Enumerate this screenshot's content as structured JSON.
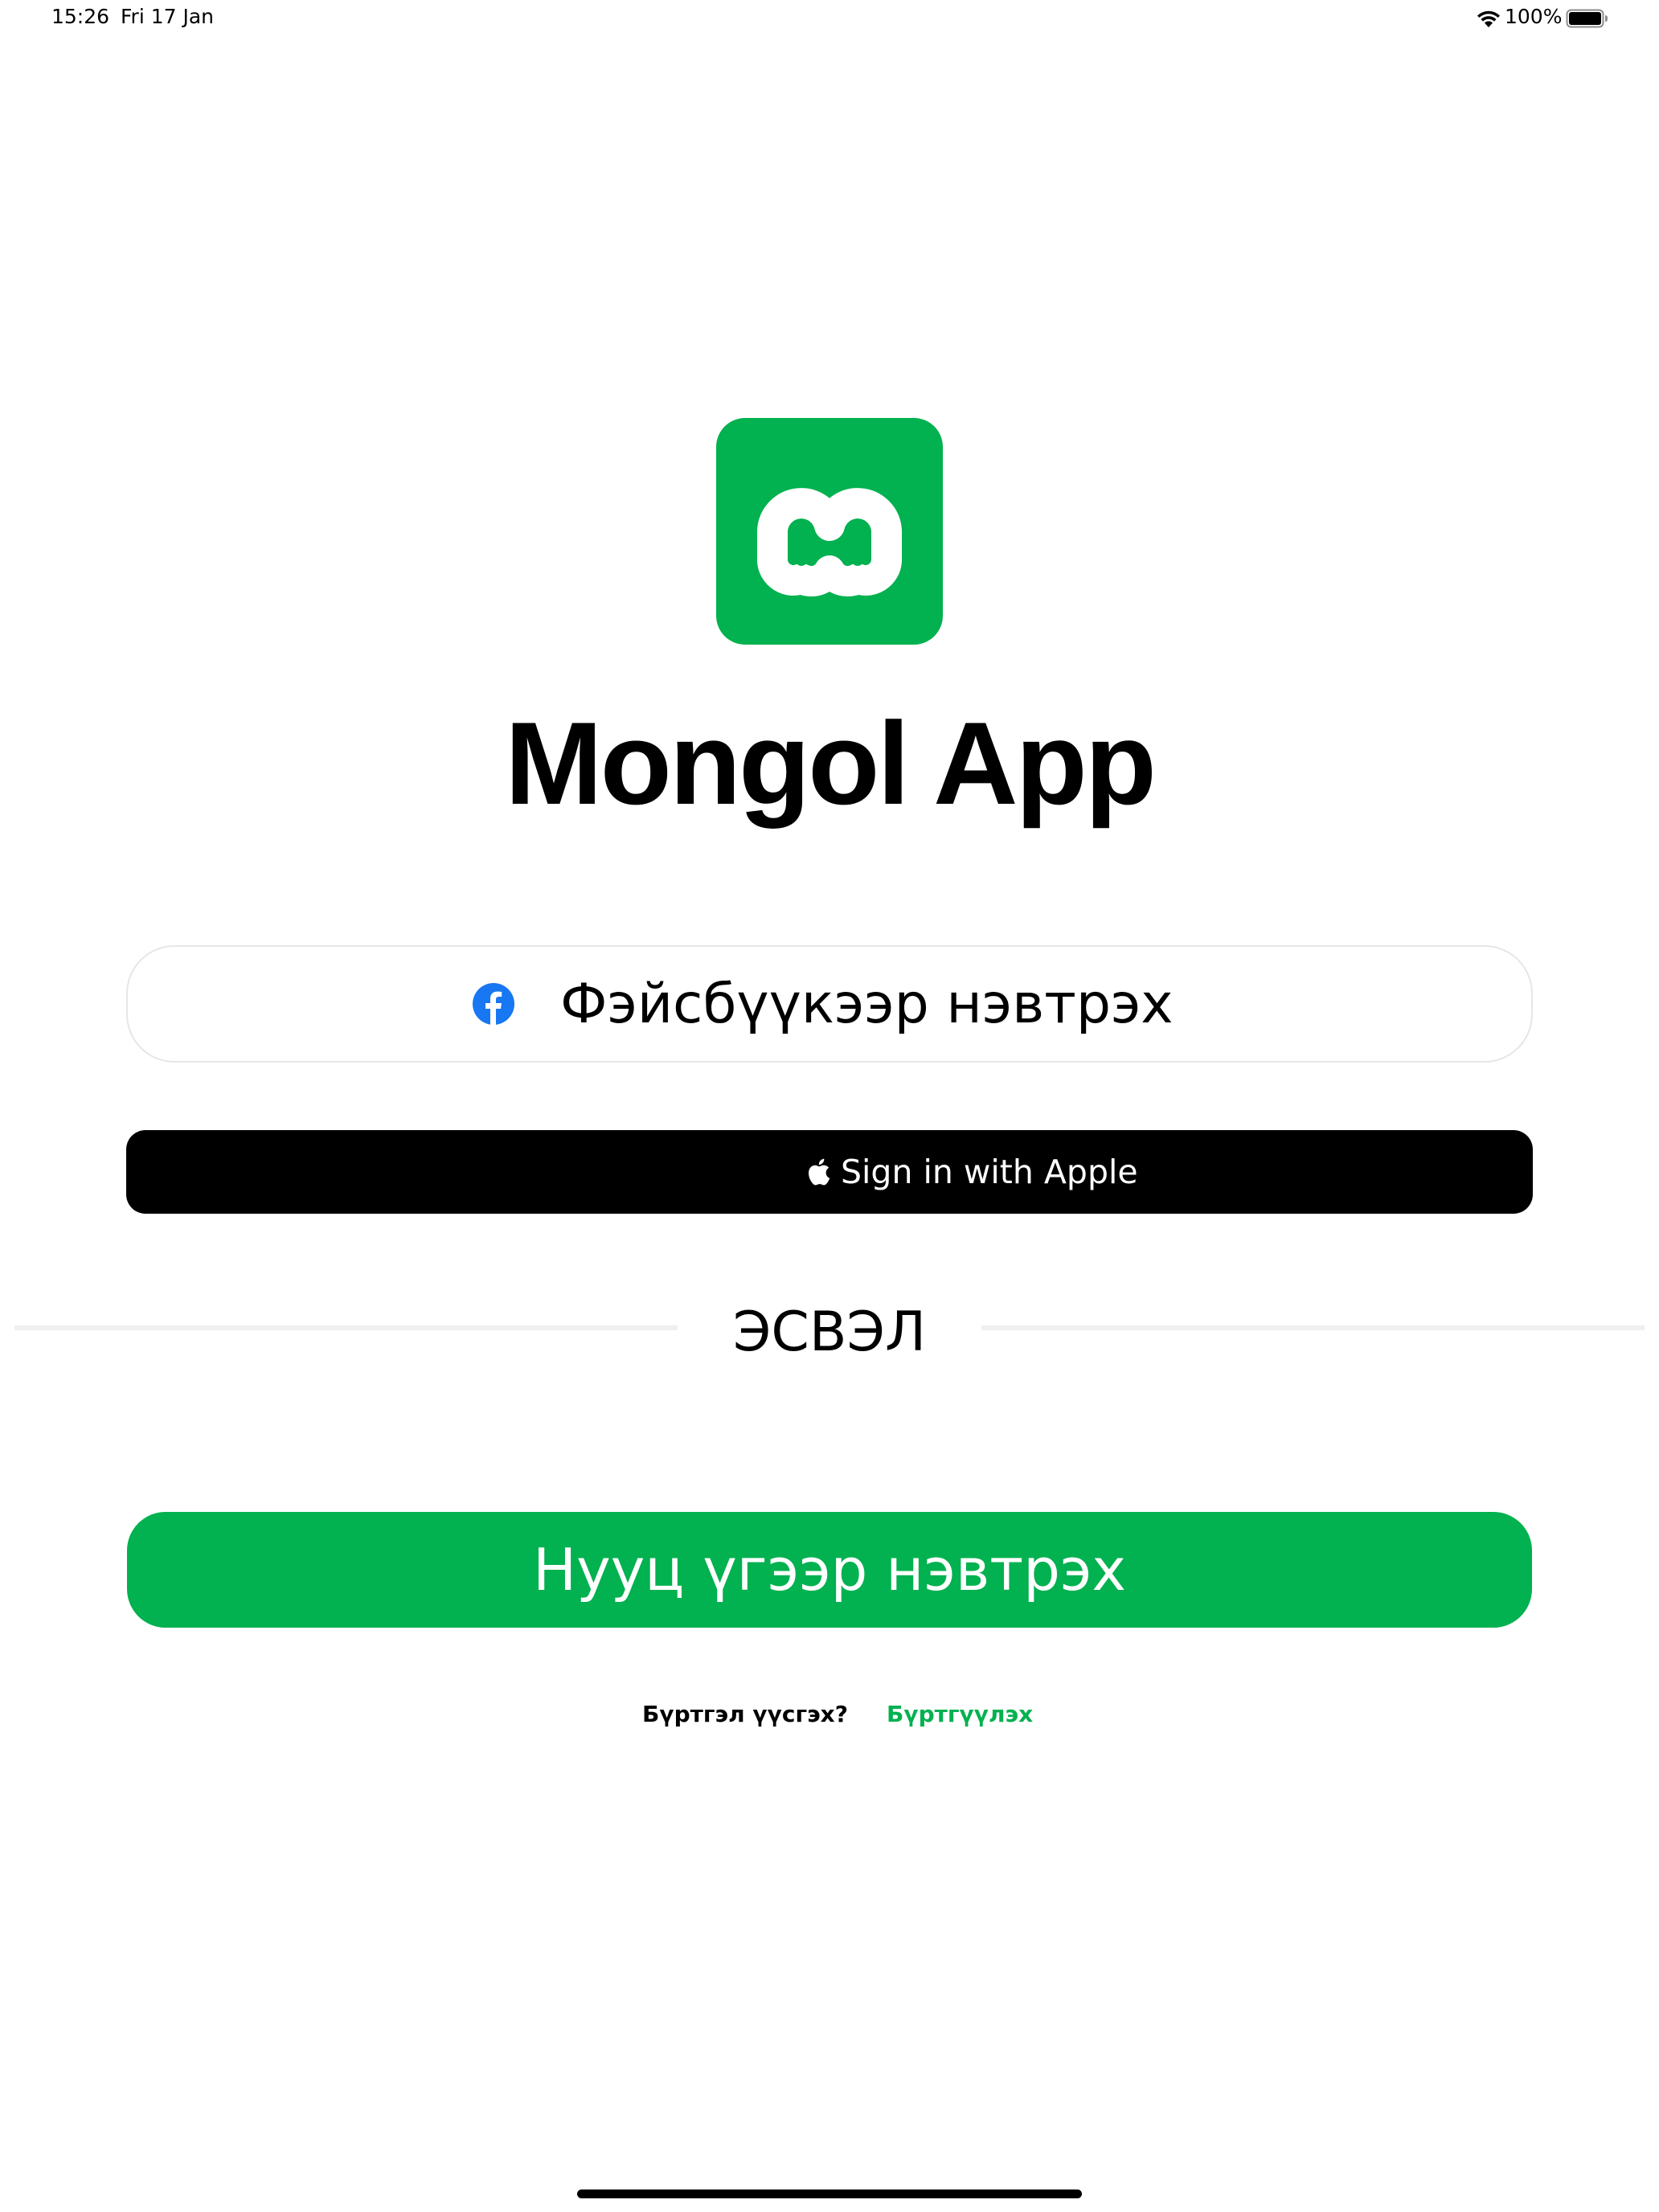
{
  "status_bar": {
    "time": "15:26",
    "date": "Fri 17 Jan",
    "battery_percent": "100%",
    "battery_level": 1.0
  },
  "app": {
    "title": "Mongol App",
    "logo_icon": "mongol-app-logo-icon",
    "brand_color": "#02b14f"
  },
  "facebook_button": {
    "label": "Фэйсбүүкээр нэвтрэх",
    "icon": "facebook-icon",
    "icon_color": "#1877f2"
  },
  "apple_button": {
    "label": "Sign in with Apple",
    "icon": "apple-icon"
  },
  "divider": {
    "label": "ЭСВЭЛ"
  },
  "password_button": {
    "label": "Нууц үгээр нэвтрэх"
  },
  "register": {
    "question": "Бүртгэл үүсгэх?",
    "link": "Бүртгүүлэх"
  }
}
